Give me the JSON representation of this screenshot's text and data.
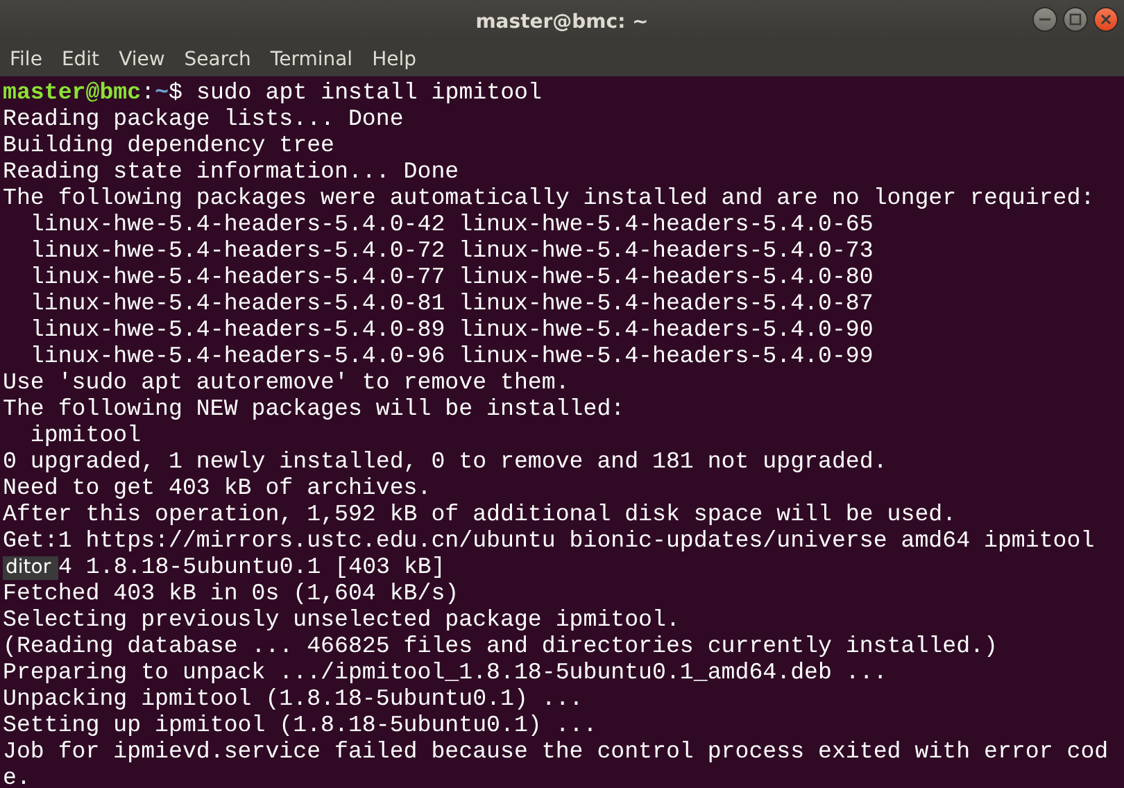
{
  "window": {
    "title": "master@bmc: ~"
  },
  "menu": [
    "File",
    "Edit",
    "View",
    "Search",
    "Terminal",
    "Help"
  ],
  "terminal": {
    "lines": [
      {
        "kind": "prompt",
        "user_host": "master@bmc",
        "separator": ":",
        "path": "~",
        "symbol": "$",
        "command": "sudo apt install ipmitool"
      },
      {
        "kind": "output",
        "text": "Reading package lists... Done"
      },
      {
        "kind": "output",
        "text": "Building dependency tree"
      },
      {
        "kind": "output",
        "text": "Reading state information... Done"
      },
      {
        "kind": "output",
        "text": "The following packages were automatically installed and are no longer required:"
      },
      {
        "kind": "output",
        "text": "  linux-hwe-5.4-headers-5.4.0-42 linux-hwe-5.4-headers-5.4.0-65"
      },
      {
        "kind": "output",
        "text": "  linux-hwe-5.4-headers-5.4.0-72 linux-hwe-5.4-headers-5.4.0-73"
      },
      {
        "kind": "output",
        "text": "  linux-hwe-5.4-headers-5.4.0-77 linux-hwe-5.4-headers-5.4.0-80"
      },
      {
        "kind": "output",
        "text": "  linux-hwe-5.4-headers-5.4.0-81 linux-hwe-5.4-headers-5.4.0-87"
      },
      {
        "kind": "output",
        "text": "  linux-hwe-5.4-headers-5.4.0-89 linux-hwe-5.4-headers-5.4.0-90"
      },
      {
        "kind": "output",
        "text": "  linux-hwe-5.4-headers-5.4.0-96 linux-hwe-5.4-headers-5.4.0-99"
      },
      {
        "kind": "output",
        "text": "Use 'sudo apt autoremove' to remove them."
      },
      {
        "kind": "output",
        "text": "The following NEW packages will be installed:"
      },
      {
        "kind": "output",
        "text": "  ipmitool"
      },
      {
        "kind": "output",
        "text": "0 upgraded, 1 newly installed, 0 to remove and 181 not upgraded."
      },
      {
        "kind": "output",
        "text": "Need to get 403 kB of archives."
      },
      {
        "kind": "output",
        "text": "After this operation, 1,592 kB of additional disk space will be used."
      },
      {
        "kind": "output",
        "text": "Get:1 https://mirrors.ustc.edu.cn/ubuntu bionic-updates/universe amd64 ipmitool"
      },
      {
        "kind": "covered",
        "text": "4 1.8.18-5ubuntu0.1 [403 kB]"
      },
      {
        "kind": "output",
        "text": "Fetched 403 kB in 0s (1,604 kB/s)"
      },
      {
        "kind": "output",
        "text": "Selecting previously unselected package ipmitool."
      },
      {
        "kind": "output",
        "text": "(Reading database ... 466825 files and directories currently installed.)"
      },
      {
        "kind": "output",
        "text": "Preparing to unpack .../ipmitool_1.8.18-5ubuntu0.1_amd64.deb ..."
      },
      {
        "kind": "output",
        "text": "Unpacking ipmitool (1.8.18-5ubuntu0.1) ..."
      },
      {
        "kind": "output",
        "text": "Setting up ipmitool (1.8.18-5ubuntu0.1) ..."
      },
      {
        "kind": "output",
        "text": "Job for ipmievd.service failed because the control process exited with error cod"
      },
      {
        "kind": "output",
        "text": "e."
      }
    ]
  },
  "tooltip": {
    "text": "ditor"
  }
}
